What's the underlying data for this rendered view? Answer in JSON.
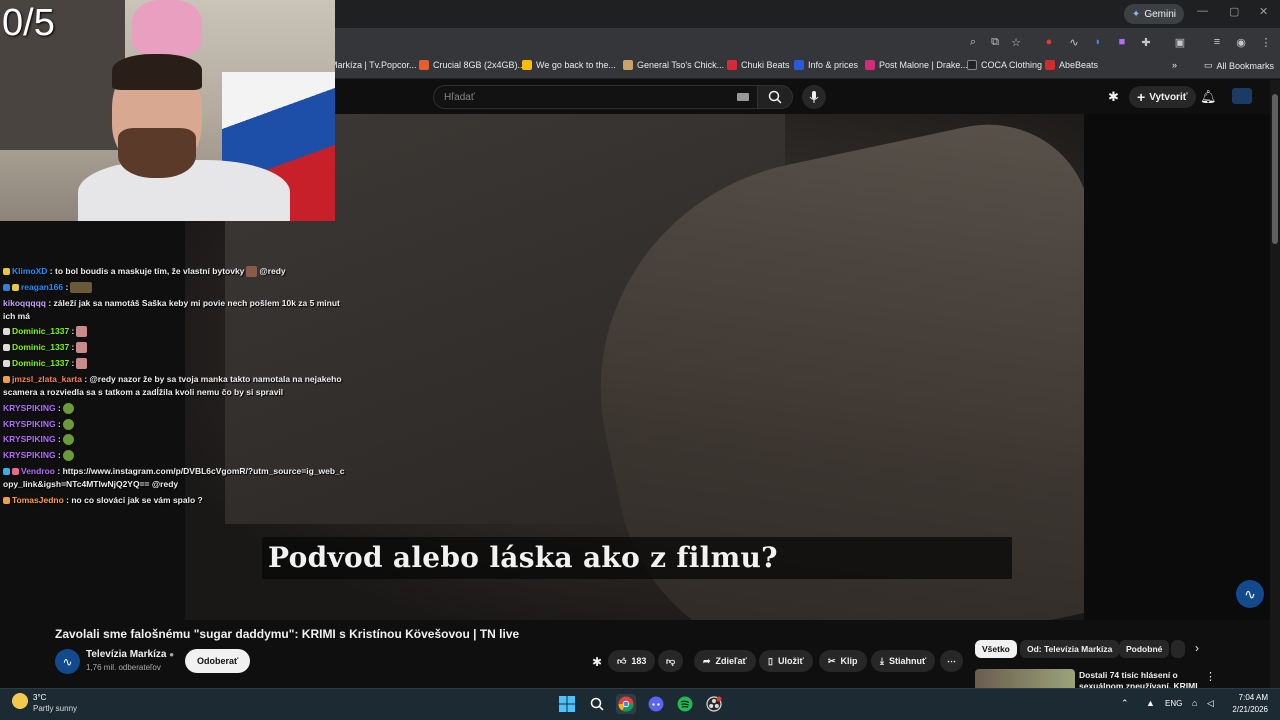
{
  "stream": {
    "counter": "0/5"
  },
  "browser": {
    "gemini_label": "Gemini",
    "bookmarks": [
      {
        "label": "Markíza | Tv.Popcor...",
        "color": "#2d6fd6"
      },
      {
        "label": "Crucial 8GB (2x4GB)...",
        "color": "#e85d2a"
      },
      {
        "label": "We go back to the...",
        "color": "#fbbc04"
      },
      {
        "label": "General Tso's Chick...",
        "color": "#c9a46a"
      },
      {
        "label": "Chuki Beats",
        "color": "#d42a3a"
      },
      {
        "label": "Info & prices",
        "color": "#2a5bd6"
      },
      {
        "label": "Post Malone | Drake...",
        "color": "#d42a7a"
      },
      {
        "label": "COCA Clothing",
        "color": "#222222"
      },
      {
        "label": "AbeBeats",
        "color": "#d42a2a"
      }
    ],
    "all_bookmarks": "All Bookmarks"
  },
  "youtube": {
    "search_placeholder": "Hľadať",
    "create_label": "Vytvoriť",
    "subtitle": "Podvod alebo láska ako z filmu?",
    "video_title": "Zavolali sme falošnému \"sugar daddymu\": KRIMI s Kristínou Kövešovou | TN live",
    "channel_name": "Televízia Markíza",
    "channel_subs": "1,76 mil. odberateľov",
    "subscribe_label": "Odoberať",
    "likes": "183",
    "share_label": "Zdieľať",
    "save_label": "Uložiť",
    "clip_label": "Klip",
    "download_label": "Stiahnuť",
    "chips": [
      "Všetko",
      "Od: Televízia Markíza",
      "Podobné"
    ],
    "related_title": "Dostali 74 tisíc hlásení o sexuálnom zneužívaní. KRIMI"
  },
  "chat": [
    {
      "user": "KlimoXD",
      "color": "#1e90ff",
      "text": ": to bol boudis a maskuje tím, že vlastní bytovky",
      "suffix": "@redy",
      "emote": true
    },
    {
      "user": "reagan166",
      "color": "#1e90ff",
      "text": ":",
      "suffix": "",
      "emote": true
    },
    {
      "user": "kikoqqqqq",
      "color": "#c79fff",
      "text": ": záleží jak sa namotáš Saška keby mi povie nech pošlem 10k za 5 minut ich má",
      "suffix": "",
      "emote": false
    },
    {
      "user": "Dominic_1337",
      "color": "#7cfc00",
      "text": ":",
      "suffix": "",
      "emote": true
    },
    {
      "user": "Dominic_1337",
      "color": "#7cfc00",
      "text": ":",
      "suffix": "",
      "emote": true
    },
    {
      "user": "Dominic_1337",
      "color": "#7cfc00",
      "text": ":",
      "suffix": "",
      "emote": true
    },
    {
      "user": "jmzsl_zlata_karta",
      "color": "#ff7f50",
      "text": ": @redy nazor že by sa tvoja manka takto namotala na nejakeho scamera a rozviedla sa s tatkom a zadĺžila kvoli nemu čo by si spravil",
      "suffix": "",
      "emote": false
    },
    {
      "user": "KRYSPIKING",
      "color": "#b36bff",
      "text": ":",
      "suffix": "",
      "emote": true
    },
    {
      "user": "KRYSPIKING",
      "color": "#b36bff",
      "text": ":",
      "suffix": "",
      "emote": true
    },
    {
      "user": "KRYSPIKING",
      "color": "#b36bff",
      "text": ":",
      "suffix": "",
      "emote": true
    },
    {
      "user": "KRYSPIKING",
      "color": "#b36bff",
      "text": ":",
      "suffix": "",
      "emote": true
    },
    {
      "user": "Vendroo",
      "color": "#b36bff",
      "text": ": https://www.instagram.com/p/DVBL6cVgomR/?utm_source=ig_web_copy_link&igsh=NTc4MTIwNjQ2YQ== @redy",
      "suffix": "",
      "emote": false
    },
    {
      "user": "TomasJedno",
      "color": "#ff9f40",
      "text": ": no co slováci jak se vám spalo ?",
      "suffix": "",
      "emote": false
    }
  ],
  "taskbar": {
    "temperature": "3°C",
    "weather": "Partly sunny",
    "language": "ENG",
    "time": "7:04 AM",
    "date": "2/21/2026"
  }
}
